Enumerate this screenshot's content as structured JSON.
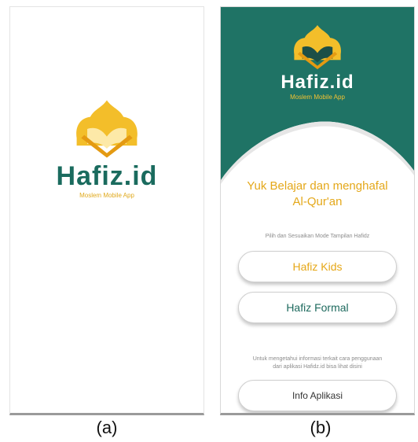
{
  "colors": {
    "teal": "#1a6b5e",
    "gold": "#f2c232",
    "orange_text": "#e4a81a"
  },
  "screen_a": {
    "logo": {
      "icon": "mosque-quran-icon",
      "name": "Hafiz.id",
      "tagline": "Moslem Mobile App"
    }
  },
  "screen_b": {
    "logo": {
      "icon": "mosque-quran-icon",
      "name": "Hafiz.id",
      "tagline": "Moslem Mobile App"
    },
    "welcome_line1": "Yuk Belajar dan menghafal",
    "welcome_line2": "Al-Qur'an",
    "mode_hint": "Pilih dan Sesuaikan Mode Tampilan Hafidz",
    "btn_kids": "Hafiz Kids",
    "btn_formal": "Hafiz Formal",
    "info_hint_line1": "Untuk mengetahui informasi terkait cara penggunaan",
    "info_hint_line2": "dari aplikasi Hafidz.id bisa lihat disini",
    "btn_info": "Info Aplikasi"
  },
  "captions": {
    "a": "(a)",
    "b": "(b)"
  }
}
